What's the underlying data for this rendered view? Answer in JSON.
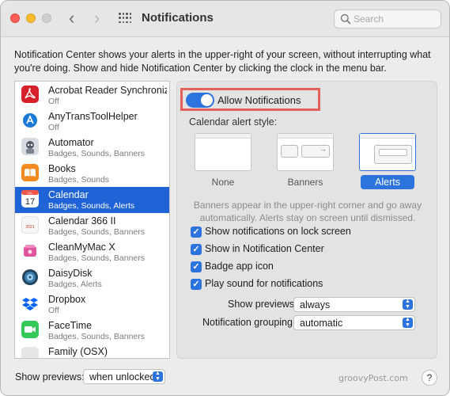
{
  "window": {
    "title": "Notifications"
  },
  "toolbar": {
    "back_icon": "chevron-left-icon",
    "forward_icon": "chevron-right-icon",
    "grid_icon": "show-all-grid-icon"
  },
  "search": {
    "placeholder": "Search",
    "value": ""
  },
  "description": "Notification Center shows your alerts in the upper-right of your screen, without interrupting what you're doing. Show and hide Notification Center by clicking the clock in the menu bar.",
  "apps": [
    {
      "name": "Acrobat Reader Synchronizer",
      "display": "Acrobat Reader Synchroniz…",
      "sub": "Off",
      "icon": "acrobat-icon",
      "color": "#d6202a"
    },
    {
      "name": "AnyTransToolHelper",
      "display": "AnyTransToolHelper",
      "sub": "Off",
      "icon": "anytrans-icon",
      "color": "#1b7ad8"
    },
    {
      "name": "Automator",
      "display": "Automator",
      "sub": "Badges, Sounds, Banners",
      "icon": "automator-icon",
      "color": "#555b66"
    },
    {
      "name": "Books",
      "display": "Books",
      "sub": "Badges, Sounds",
      "icon": "books-icon",
      "color": "#f58a1f"
    },
    {
      "name": "Calendar",
      "display": "Calendar",
      "sub": "Badges, Sounds, Alerts",
      "icon": "calendar-icon",
      "color": "#ffffff",
      "selected": true
    },
    {
      "name": "Calendar 366 II",
      "display": "Calendar 366 II",
      "sub": "Badges, Sounds, Banners",
      "icon": "calendar-366-icon",
      "color": "#f3f3f3"
    },
    {
      "name": "CleanMyMac X",
      "display": "CleanMyMac X",
      "sub": "Badges, Sounds, Banners",
      "icon": "cleanmymac-icon",
      "color": "#e0559b"
    },
    {
      "name": "DaisyDisk",
      "display": "DaisyDisk",
      "sub": "Badges, Alerts",
      "icon": "daisydisk-icon",
      "color": "#22445f"
    },
    {
      "name": "Dropbox",
      "display": "Dropbox",
      "sub": "Off",
      "icon": "dropbox-icon",
      "color": "#ffffff"
    },
    {
      "name": "FaceTime",
      "display": "FaceTime",
      "sub": "Badges, Sounds, Banners",
      "icon": "facetime-icon",
      "color": "#34c759"
    },
    {
      "name": "Family (OSX)",
      "display": "Family (OSX)",
      "sub": "",
      "icon": "family-icon",
      "color": "#e6e6e6"
    }
  ],
  "calendar_icon": {
    "month": "JUL",
    "day": "17"
  },
  "calendar366_icon": {
    "year": "2021"
  },
  "settings": {
    "allow_label": "Allow Notifications",
    "allow_enabled": true,
    "alert_style_label": "Calendar alert style:",
    "styles": [
      "None",
      "Banners",
      "Alerts"
    ],
    "selected_style": "Alerts",
    "banner_note": "Banners appear in the upper-right corner and go away automatically. Alerts stay on screen until dismissed.",
    "checkboxes": [
      {
        "label": "Show notifications on lock screen",
        "checked": true
      },
      {
        "label": "Show in Notification Center",
        "checked": true
      },
      {
        "label": "Badge app icon",
        "checked": true
      },
      {
        "label": "Play sound for notifications",
        "checked": true
      }
    ],
    "show_previews": {
      "label": "Show previews",
      "value": "always"
    },
    "grouping": {
      "label": "Notification grouping",
      "value": "automatic"
    }
  },
  "footer": {
    "show_previews_label": "Show previews:",
    "show_previews_value": "when unlocked",
    "watermark": "groovyPost.com",
    "help": "?"
  },
  "colors": {
    "accent": "#2c73de",
    "selection": "#1f63d6",
    "highlight_box": "#e2615b"
  }
}
